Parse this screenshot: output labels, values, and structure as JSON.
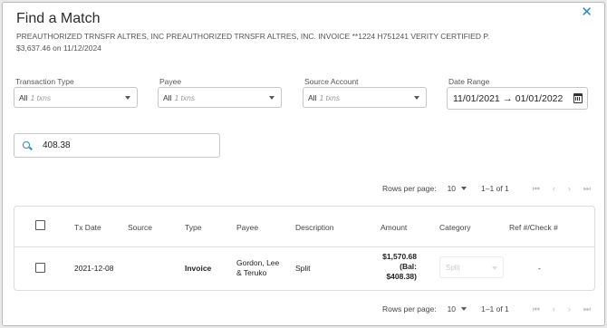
{
  "dialog": {
    "title": "Find a Match",
    "description_line1": "PREAUTHORIZED TRNSFR ALTRES, INC PREAUTHORIZED TRNSFR ALTRES, INC. INVOICE **1224 H751241 VERITY CERTIFIED P.",
    "description_line2": "$3,637.46 on 11/12/2024",
    "close_icon": "close-icon"
  },
  "filters": {
    "transaction_type": {
      "label": "Transaction Type",
      "value": "All",
      "hint": "1 txns"
    },
    "payee": {
      "label": "Payee",
      "value": "All",
      "hint": "1 txns"
    },
    "source_account": {
      "label": "Source Account",
      "value": "All",
      "hint": "1 txns"
    },
    "date_range": {
      "label": "Date Range",
      "from": "11/01/2021",
      "arrow": "→",
      "to": "01/01/2022",
      "icon": "calendar-icon"
    }
  },
  "search": {
    "value": "408.38",
    "icon": "search-icon"
  },
  "pagination_top": {
    "rows_label": "Rows per page:",
    "rows_value": "10",
    "range": "1–1 of 1"
  },
  "pagination_bottom": {
    "rows_label": "Rows per page:",
    "rows_value": "10",
    "range": "1–1 of 1"
  },
  "pager_icons": {
    "first": "⏮",
    "prev": "‹",
    "next": "›",
    "last": "⏭"
  },
  "table": {
    "headers": [
      "Tx Date",
      "Source",
      "Type",
      "Payee",
      "Description",
      "Amount",
      "Category",
      "Ref #/Check #"
    ],
    "rows": [
      {
        "tx_date": "2021-12-08",
        "source": "",
        "type": "Invoice",
        "payee_line1": "Gordon, Lee",
        "payee_line2": "& Teruko",
        "description": "Split",
        "amount_line1": "$1,570.68",
        "amount_line2": "(Bal:",
        "amount_line3": "$408.38)",
        "category": "Split",
        "ref": "-"
      }
    ]
  }
}
